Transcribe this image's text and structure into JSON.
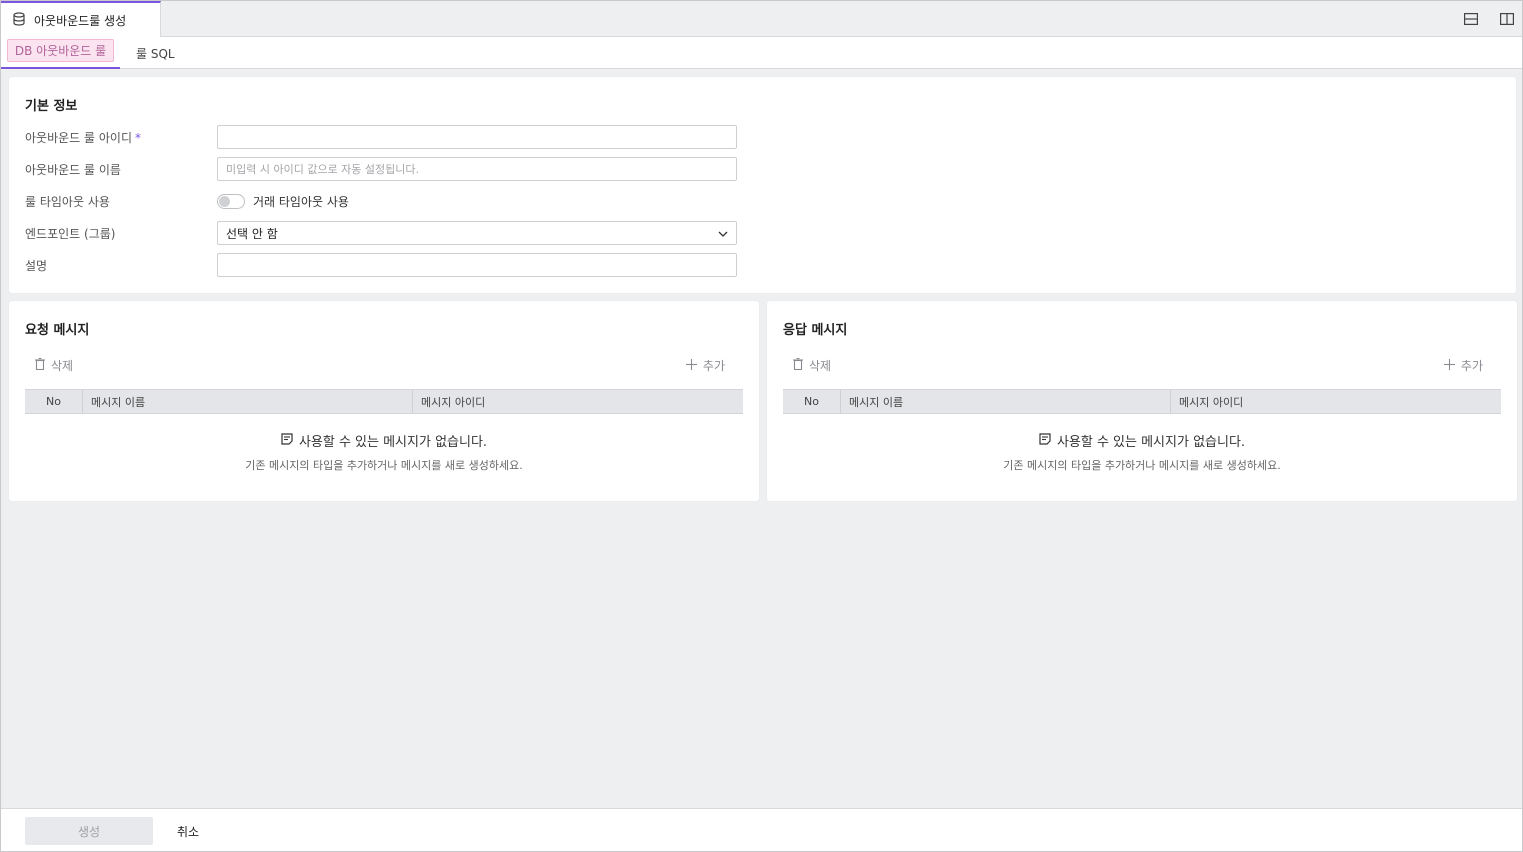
{
  "window": {
    "tab_title": "아웃바운드룰 생성",
    "tab_icon": "database-icon"
  },
  "subtabs": [
    {
      "label": "DB 아웃바운드 룰",
      "active": true
    },
    {
      "label": "룰 SQL",
      "active": false
    }
  ],
  "basic_info": {
    "title": "기본 정보",
    "fields": {
      "rule_id": {
        "label": "아웃바운드 룰 아이디",
        "required_mark": "*",
        "value": ""
      },
      "rule_name": {
        "label": "아웃바운드 룰 이름",
        "placeholder": "미입력 시 아이디 값으로 자동 설정됩니다.",
        "value": ""
      },
      "timeout": {
        "label": "룰 타임아웃 사용",
        "toggle_label": "거래 타임아웃 사용",
        "enabled": false
      },
      "endpoint": {
        "label": "엔드포인트 (그룹)",
        "value": "선택 안 함"
      },
      "description": {
        "label": "설명",
        "value": ""
      }
    }
  },
  "request_panel": {
    "title": "요청 메시지",
    "delete_label": "삭제",
    "add_label": "추가",
    "columns": {
      "no": "No",
      "name": "메시지 이름",
      "id": "메시지 아이디"
    },
    "empty_title": "사용할 수 있는 메시지가 없습니다.",
    "empty_desc": "기존 메시지의 타입을 추가하거나 메시지를 새로 생성하세요."
  },
  "response_panel": {
    "title": "응답 메시지",
    "delete_label": "삭제",
    "add_label": "추가",
    "columns": {
      "no": "No",
      "name": "메시지 이름",
      "id": "메시지 아이디"
    },
    "empty_title": "사용할 수 있는 메시지가 없습니다.",
    "empty_desc": "기존 메시지의 타입을 추가하거나 메시지를 새로 생성하세요."
  },
  "footer": {
    "create_label": "생성",
    "cancel_label": "취소"
  },
  "colors": {
    "accent": "#7a55e0",
    "active_subtab_bg": "#fbe3ef",
    "active_subtab_text": "#b0639a",
    "background": "#eeeff1"
  }
}
